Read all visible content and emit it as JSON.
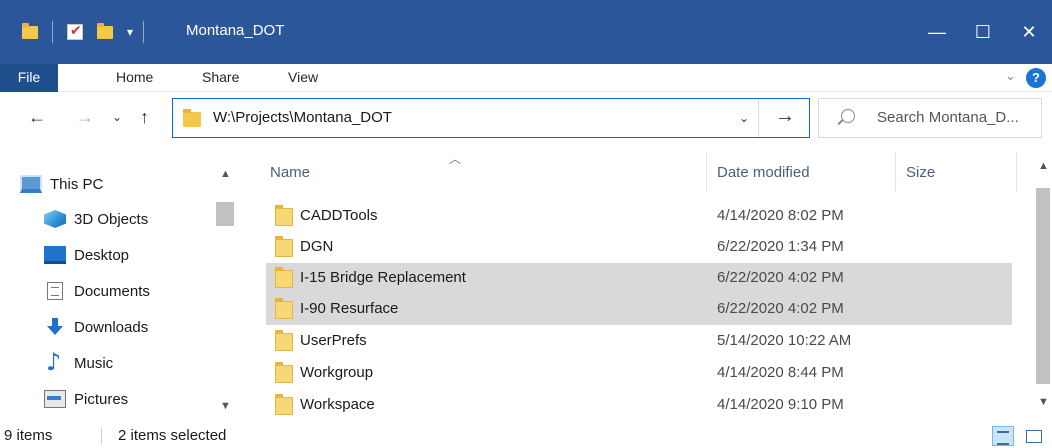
{
  "window": {
    "title": "Montana_DOT",
    "minimize": "—",
    "maximize": "☐",
    "close": "✕",
    "qat_dropdown": "▾"
  },
  "ribbon": {
    "tabs": [
      "File",
      "Home",
      "Share",
      "View"
    ],
    "collapse": "⌄",
    "help": "?"
  },
  "address": {
    "back": "←",
    "forward": "→",
    "recent": "⌄",
    "up": "↑",
    "path": "W:\\Projects\\Montana_DOT",
    "dropdown": "⌄",
    "go": "→"
  },
  "search": {
    "placeholder": "Search Montana_D..."
  },
  "nav": {
    "items": [
      {
        "label": "This PC",
        "icon": "pc-icon"
      },
      {
        "label": "3D Objects",
        "icon": "3d-objects-icon"
      },
      {
        "label": "Desktop",
        "icon": "desktop-icon"
      },
      {
        "label": "Documents",
        "icon": "documents-icon"
      },
      {
        "label": "Downloads",
        "icon": "downloads-icon"
      },
      {
        "label": "Music",
        "icon": "music-icon"
      },
      {
        "label": "Pictures",
        "icon": "pictures-icon"
      }
    ],
    "scroll_up": "▲",
    "scroll_down": "▼"
  },
  "columns": {
    "name": "Name",
    "date": "Date modified",
    "size": "Size",
    "sort": "︿"
  },
  "files": [
    {
      "name": "CADDTools",
      "date": "4/14/2020 8:02 PM",
      "selected": false
    },
    {
      "name": "DGN",
      "date": "6/22/2020 1:34 PM",
      "selected": false
    },
    {
      "name": "I-15 Bridge Replacement",
      "date": "6/22/2020 4:02 PM",
      "selected": true
    },
    {
      "name": "I-90 Resurface",
      "date": "6/22/2020 4:02 PM",
      "selected": true
    },
    {
      "name": "UserPrefs",
      "date": "5/14/2020 10:22 AM",
      "selected": false
    },
    {
      "name": "Workgroup",
      "date": "4/14/2020 8:44 PM",
      "selected": false
    },
    {
      "name": "Workspace",
      "date": "4/14/2020 9:10 PM",
      "selected": false
    }
  ],
  "status": {
    "items": "9 items",
    "selected": "2 items selected"
  },
  "colors": {
    "titlebar": "#2b579a",
    "selection": "#d9d9d9",
    "accent": "#0a68d0"
  }
}
